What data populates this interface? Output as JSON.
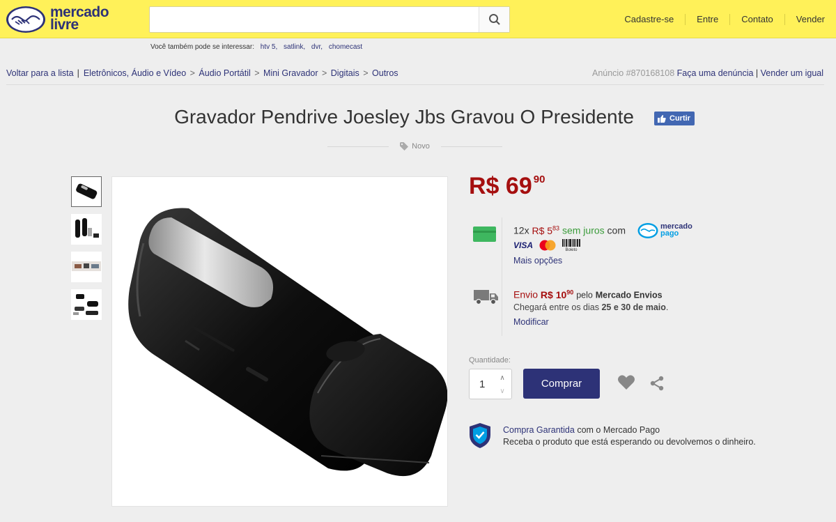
{
  "header": {
    "logo_line1": "mercado",
    "logo_line2": "livre",
    "search_value": "",
    "nav": [
      "Cadastre-se",
      "Entre",
      "Contato",
      "Vender"
    ]
  },
  "suggestions": {
    "label": "Você também pode se interessar:",
    "items": [
      "htv 5,",
      "satlink,",
      "dvr,",
      "chomecast"
    ]
  },
  "breadcrumb": {
    "back": "Voltar para a lista",
    "path": [
      "Eletrônicos, Áudio e Vídeo",
      "Áudio Portátil",
      "Mini Gravador",
      "Digitais",
      "Outros"
    ],
    "listing_id": "Anúncio #870168108",
    "report": "Faça uma denúncia",
    "sell_same": "Vender um igual"
  },
  "product": {
    "title": "Gravador Pendrive Joesley Jbs Gravou O Presidente",
    "like_label": "Curtir",
    "condition": "Novo",
    "price_main": "R$ 69",
    "price_cents": "90"
  },
  "installments": {
    "prefix": "12x ",
    "amount": "R$ 5",
    "cents": "83",
    "interest": "sem juros",
    "suffix": "com",
    "mp_line1": "mercado",
    "mp_line2": "pago",
    "card_brands": [
      "VISA",
      "Boleto"
    ],
    "more_options": "Mais opções"
  },
  "shipping": {
    "label": "Envio ",
    "price": "R$ 10",
    "cents": "90",
    "by": "pelo",
    "carrier": "Mercado Envios",
    "arrival_prefix": "Chegará entre os dias ",
    "arrival_dates": "25 e 30 de maio",
    "arrival_suffix": ".",
    "modify": "Modificar"
  },
  "purchase": {
    "quantity_label": "Quantidade:",
    "quantity": "1",
    "buy_label": "Comprar"
  },
  "guarantee": {
    "link": "Compra Garantida",
    "text": "com o Mercado Pago",
    "line2": "Receba o produto que está esperando ou devolvemos o dinheiro."
  },
  "colors": {
    "header_bg": "#fff159",
    "brand_blue": "#2d3277",
    "price_red": "#a50f0f",
    "interest_green": "#3a9b3a"
  }
}
